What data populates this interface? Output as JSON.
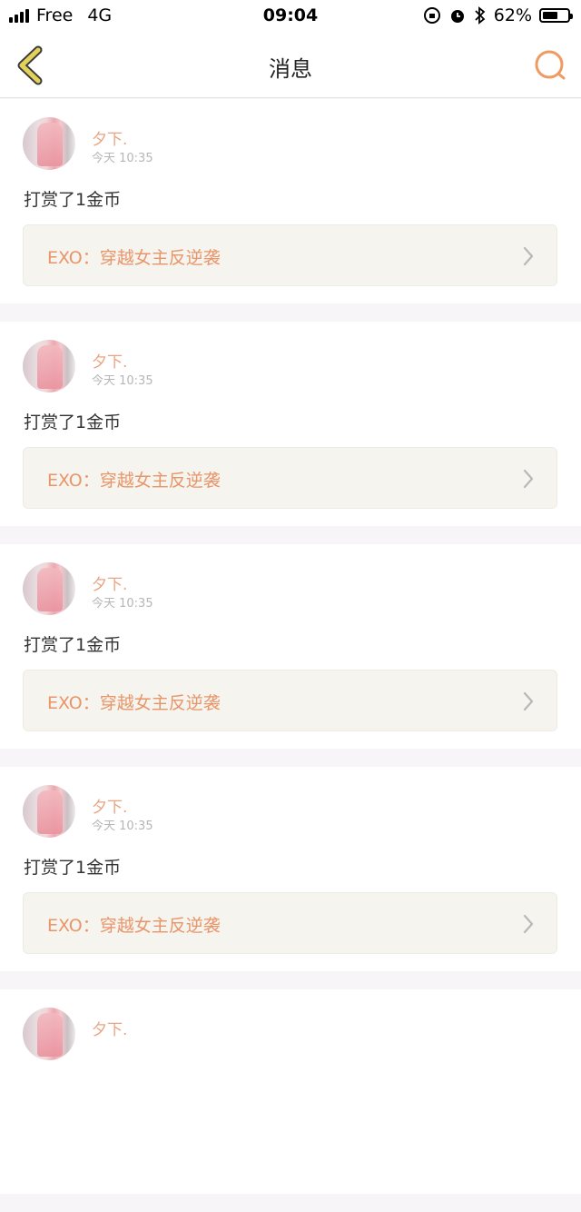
{
  "status_bar": {
    "carrier": "Free",
    "network": "4G",
    "time": "09:04",
    "battery": "62%",
    "battery_level": 0.62
  },
  "nav": {
    "title": "消息"
  },
  "colors": {
    "accent": "#e9956a",
    "back_icon": "#e2d15a",
    "search_icon": "#ef9a62"
  },
  "messages": [
    {
      "user": "夕下.",
      "time": "今天 10:35",
      "text": "打赏了1金币",
      "book": "EXO：穿越女主反逆袭"
    },
    {
      "user": "夕下.",
      "time": "今天 10:35",
      "text": "打赏了1金币",
      "book": "EXO：穿越女主反逆袭"
    },
    {
      "user": "夕下.",
      "time": "今天 10:35",
      "text": "打赏了1金币",
      "book": "EXO：穿越女主反逆袭"
    },
    {
      "user": "夕下.",
      "time": "今天 10:35",
      "text": "打赏了1金币",
      "book": "EXO：穿越女主反逆袭"
    },
    {
      "user": "夕下.",
      "time": "",
      "text": "",
      "book": ""
    }
  ]
}
